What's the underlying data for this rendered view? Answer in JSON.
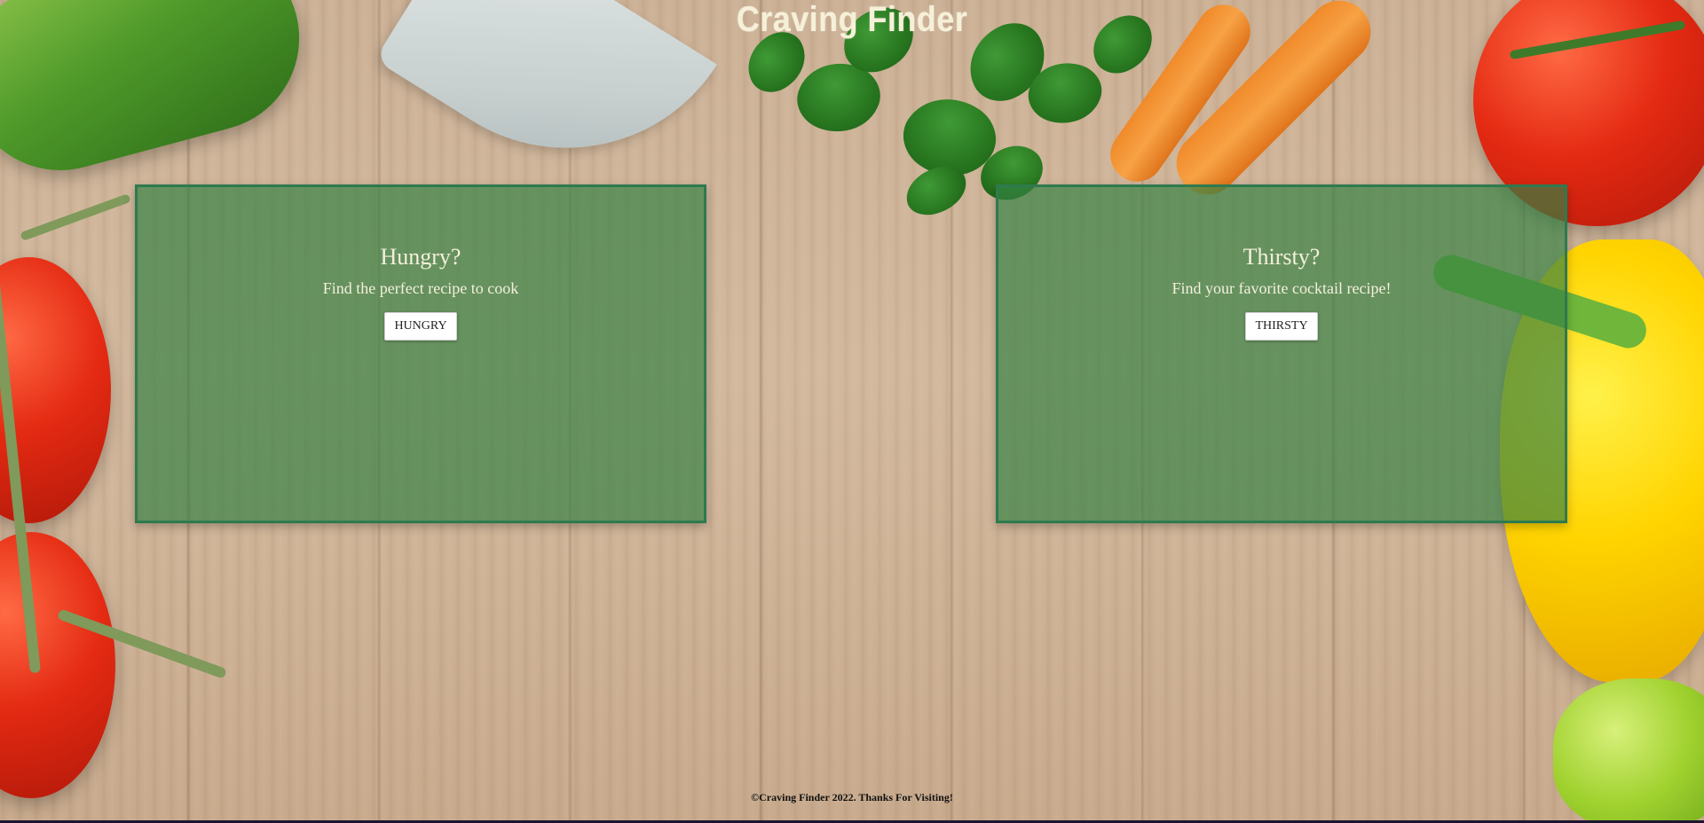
{
  "header": {
    "title": "Craving Finder"
  },
  "cards": {
    "hungry": {
      "heading": "Hungry?",
      "text": "Find the perfect recipe to cook",
      "button": "HUNGRY"
    },
    "thirsty": {
      "heading": "Thirsty?",
      "text": "Find your favorite cocktail recipe!",
      "button": "THIRSTY"
    }
  },
  "footer": {
    "text": "©Craving Finder 2022. Thanks For Visiting!"
  },
  "colors": {
    "card_background": "#348042",
    "card_border": "#2e7a4e",
    "title_text": "#f6f0d8",
    "button_background": "#ffffff"
  }
}
